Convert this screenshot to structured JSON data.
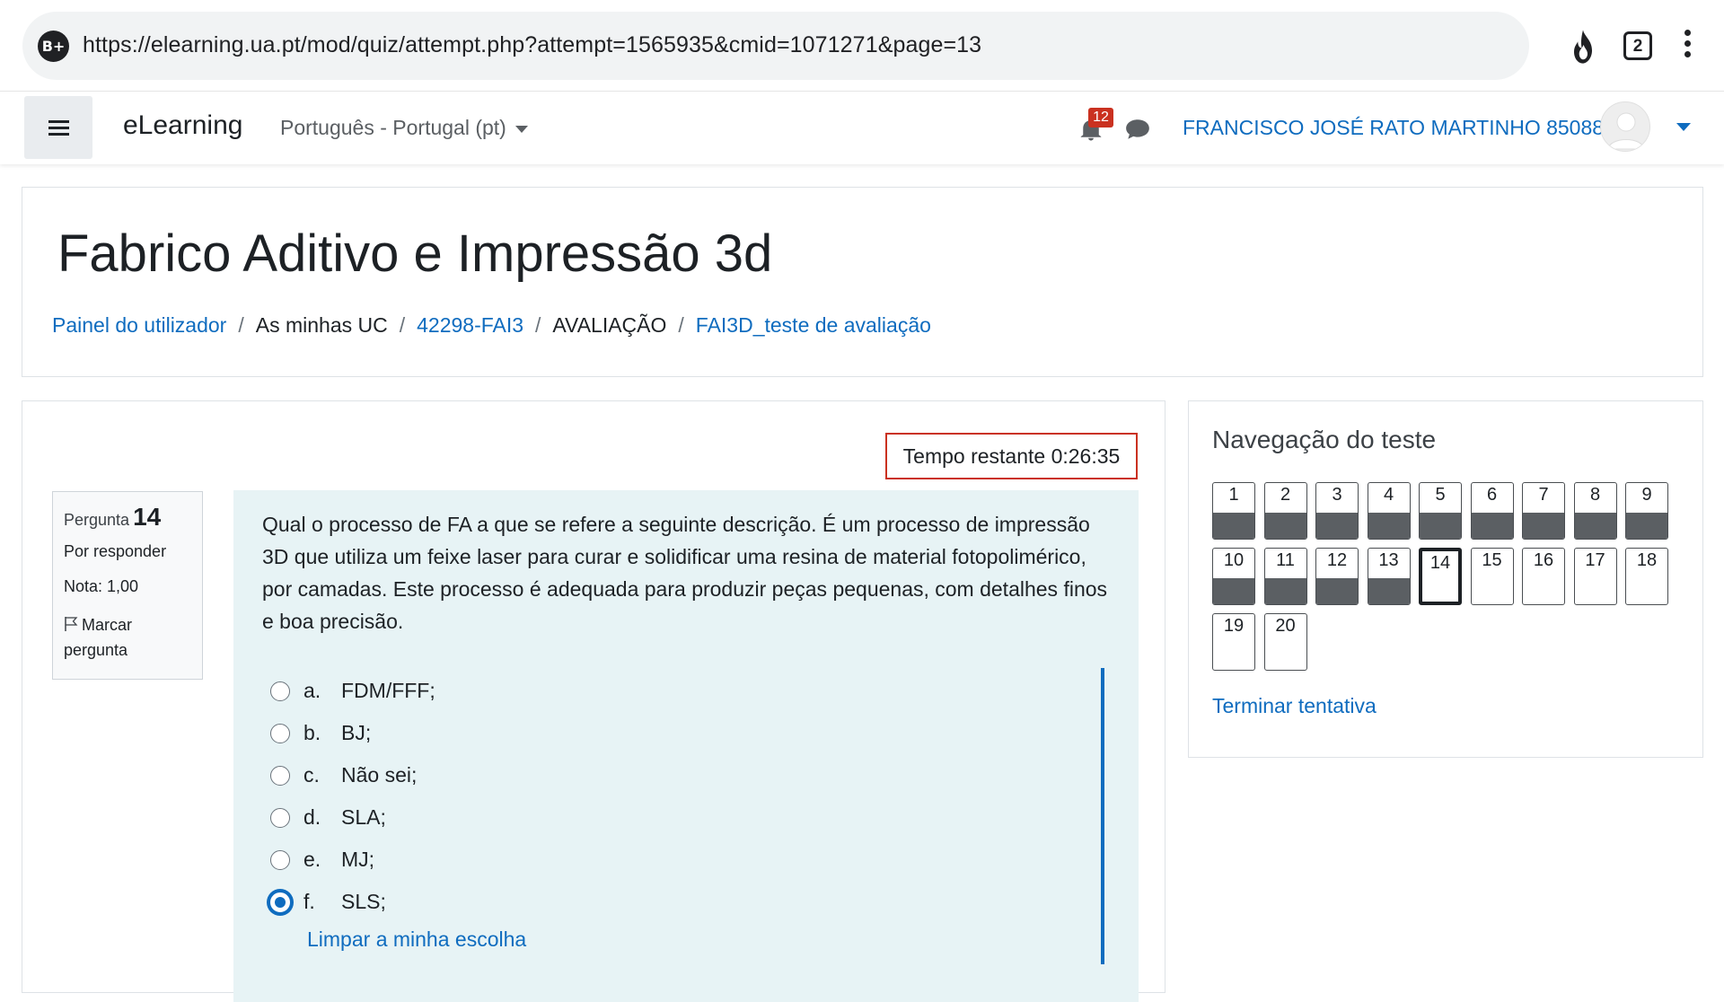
{
  "browser": {
    "site_badge": "B+",
    "url": "https://elearning.ua.pt/mod/quiz/attempt.php?attempt=1565935&cmid=1071271&page=13",
    "tab_count": "2",
    "flame_icon": "flame-icon",
    "menu_icon": "kebab-menu-icon"
  },
  "navbar": {
    "brand": "eLearning",
    "language": "Português - Portugal (pt)",
    "notification_count": "12",
    "user_name": "FRANCISCO JOSÉ RATO MARTINHO 85088"
  },
  "header": {
    "course_title": "Fabrico Aditivo e Impressão 3d",
    "breadcrumb": [
      {
        "label": "Painel do utilizador",
        "link": true
      },
      {
        "label": "As minhas UC",
        "link": false
      },
      {
        "label": "42298-FAI3",
        "link": true
      },
      {
        "label": "AVALIAÇÃO",
        "link": false
      },
      {
        "label": "FAI3D_teste de avaliação",
        "link": true
      }
    ],
    "separator": "/"
  },
  "quiz": {
    "timer": "Tempo restante 0:26:35",
    "question_info": {
      "label": "Pergunta",
      "number": "14",
      "state": "Por responder",
      "grade": "Nota: 1,00",
      "flag_label": "Marcar pergunta"
    },
    "question_text": "Qual o processo de FA a que se refere a seguinte descrição. É um processo de impressão 3D que utiliza um feixe laser para curar e solidificar uma resina de material fotopolimérico, por camadas. Este processo é adequada para produzir peças pequenas, com detalhes finos e boa precisão.",
    "answers": [
      {
        "letter": "a.",
        "text": "FDM/FFF;",
        "selected": false
      },
      {
        "letter": "b.",
        "text": "BJ;",
        "selected": false
      },
      {
        "letter": "c.",
        "text": "Não sei;",
        "selected": false
      },
      {
        "letter": "d.",
        "text": "SLA;",
        "selected": false
      },
      {
        "letter": "e.",
        "text": "MJ;",
        "selected": false
      },
      {
        "letter": "f.",
        "text": "SLS;",
        "selected": true
      }
    ],
    "clear_choice": "Limpar a minha escolha"
  },
  "navigation": {
    "title": "Navegação do teste",
    "questions": [
      {
        "n": "1",
        "answered": true
      },
      {
        "n": "2",
        "answered": true
      },
      {
        "n": "3",
        "answered": true
      },
      {
        "n": "4",
        "answered": true
      },
      {
        "n": "5",
        "answered": true
      },
      {
        "n": "6",
        "answered": true
      },
      {
        "n": "7",
        "answered": true
      },
      {
        "n": "8",
        "answered": true
      },
      {
        "n": "9",
        "answered": true
      },
      {
        "n": "10",
        "answered": true
      },
      {
        "n": "11",
        "answered": true
      },
      {
        "n": "12",
        "answered": true
      },
      {
        "n": "13",
        "answered": true
      },
      {
        "n": "14",
        "answered": false,
        "current": true
      },
      {
        "n": "15",
        "answered": false
      },
      {
        "n": "16",
        "answered": false
      },
      {
        "n": "17",
        "answered": false
      },
      {
        "n": "18",
        "answered": false
      },
      {
        "n": "19",
        "answered": false
      },
      {
        "n": "20",
        "answered": false
      }
    ],
    "finish": "Terminar tentativa"
  },
  "colors": {
    "link": "#0f6cbf",
    "timer_border": "#ca3120",
    "question_bg": "#e7f3f5",
    "answered_fill": "#5b5f63"
  }
}
